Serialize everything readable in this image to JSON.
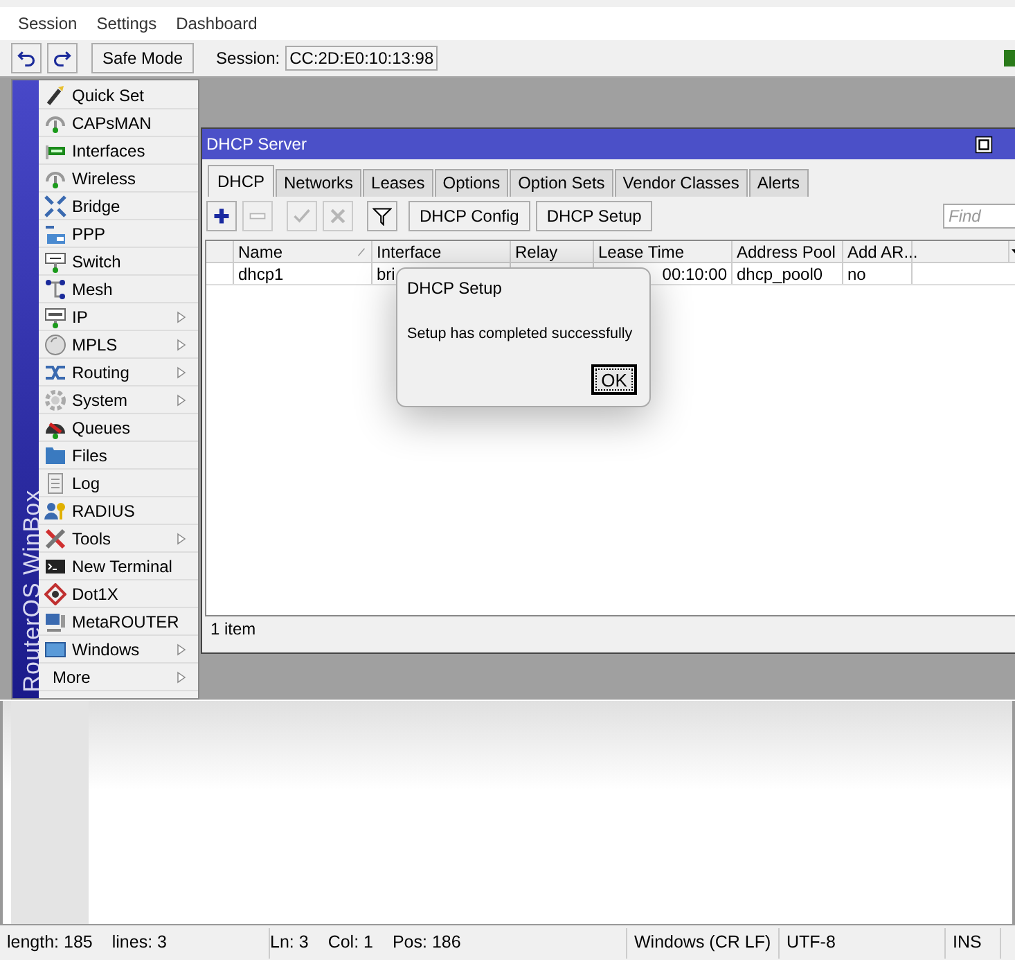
{
  "menu_bar": [
    "Session",
    "Settings",
    "Dashboard"
  ],
  "toolbar": {
    "safe_mode": "Safe Mode",
    "session_label": "Session:",
    "session_value": "CC:2D:E0:10:13:98"
  },
  "side_menu": {
    "brand": "RouterOS WinBox",
    "items": [
      {
        "label": "Quick Set",
        "submenu": false
      },
      {
        "label": "CAPsMAN",
        "submenu": false
      },
      {
        "label": "Interfaces",
        "submenu": false
      },
      {
        "label": "Wireless",
        "submenu": false
      },
      {
        "label": "Bridge",
        "submenu": false
      },
      {
        "label": "PPP",
        "submenu": false
      },
      {
        "label": "Switch",
        "submenu": false
      },
      {
        "label": "Mesh",
        "submenu": false
      },
      {
        "label": "IP",
        "submenu": true
      },
      {
        "label": "MPLS",
        "submenu": true
      },
      {
        "label": "Routing",
        "submenu": true
      },
      {
        "label": "System",
        "submenu": true
      },
      {
        "label": "Queues",
        "submenu": false
      },
      {
        "label": "Files",
        "submenu": false
      },
      {
        "label": "Log",
        "submenu": false
      },
      {
        "label": "RADIUS",
        "submenu": false
      },
      {
        "label": "Tools",
        "submenu": true
      },
      {
        "label": "New Terminal",
        "submenu": false
      },
      {
        "label": "Dot1X",
        "submenu": false
      },
      {
        "label": "MetaROUTER",
        "submenu": false
      },
      {
        "label": "Windows",
        "submenu": true
      },
      {
        "label": "More",
        "submenu": true
      }
    ]
  },
  "dhcp_window": {
    "title": "DHCP Server",
    "tabs": [
      {
        "label": "DHCP",
        "selected": true
      },
      {
        "label": "Networks",
        "selected": false
      },
      {
        "label": "Leases",
        "selected": false
      },
      {
        "label": "Options",
        "selected": false
      },
      {
        "label": "Option Sets",
        "selected": false
      },
      {
        "label": "Vendor Classes",
        "selected": false
      },
      {
        "label": "Alerts",
        "selected": false
      }
    ],
    "icon_buttons": [
      {
        "kind": "add",
        "disabled": false
      },
      {
        "kind": "remove",
        "disabled": true
      },
      {
        "kind": "enable",
        "disabled": true
      },
      {
        "kind": "disable",
        "disabled": true
      },
      {
        "kind": "filter",
        "disabled": false
      }
    ],
    "text_buttons": [
      "DHCP Config",
      "DHCP Setup"
    ],
    "find_placeholder": "Find",
    "table": {
      "columns": [
        "Name",
        "Interface",
        "Relay",
        "Lease Time",
        "Address Pool",
        "Add AR..."
      ],
      "rows": [
        [
          "dhcp1",
          "bri",
          null,
          "00:10:00",
          "dhcp_pool0",
          "no"
        ]
      ]
    },
    "footer": "1 item"
  },
  "dialog": {
    "title": "DHCP Setup",
    "message": "Setup has completed successfully",
    "button": "OK"
  },
  "editor_status": [
    "length: 185",
    "lines: 3",
    "Ln: 3",
    "Col: 1",
    "Pos: 186",
    "Windows (CR LF)",
    "UTF-8",
    "INS"
  ]
}
